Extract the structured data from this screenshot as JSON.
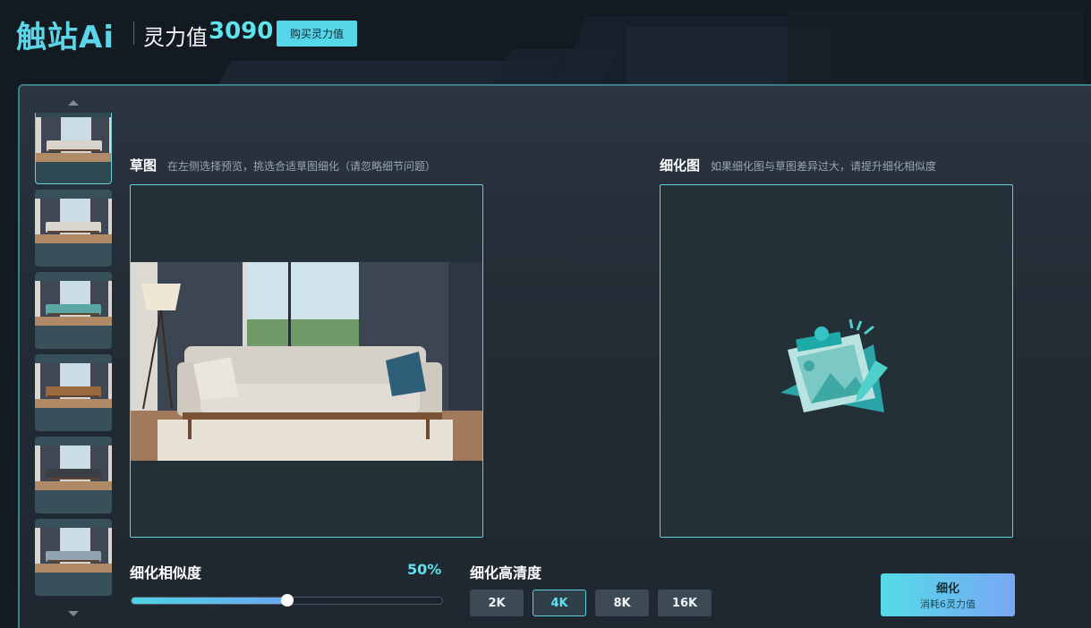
{
  "header": {
    "logo_main": "触站",
    "logo_ai": "Ai",
    "power_label": "灵力值",
    "power_value": "3090",
    "buy_button": "购买灵力值"
  },
  "sketch": {
    "title": "草图",
    "hint": "在左侧选择预览，挑选合适草图细化（请忽略细节问题）"
  },
  "refined": {
    "title": "细化图",
    "hint": "如果细化图与草图差异过大，请提升细化相似度"
  },
  "similarity": {
    "label": "细化相似度",
    "value_text": "50%",
    "value": 0.5
  },
  "resolution": {
    "label": "细化高清度",
    "options": [
      "2K",
      "4K",
      "8K",
      "16K"
    ],
    "selected": "4K"
  },
  "refine_button": {
    "label": "细化",
    "cost": "消耗6灵力值"
  },
  "thumbnails": [
    {
      "sofa": "#d8d4cc",
      "selected": true
    },
    {
      "sofa": "#d9d6cf",
      "selected": false
    },
    {
      "sofa": "#5aa7a3",
      "selected": false
    },
    {
      "sofa": "#9a6a3e",
      "selected": false
    },
    {
      "sofa": "#3a3f46",
      "selected": false
    },
    {
      "sofa": "#8fa3b1",
      "selected": false
    }
  ],
  "colors": {
    "accent": "#5ee3ee",
    "panel_border": "#5fd2dd"
  }
}
